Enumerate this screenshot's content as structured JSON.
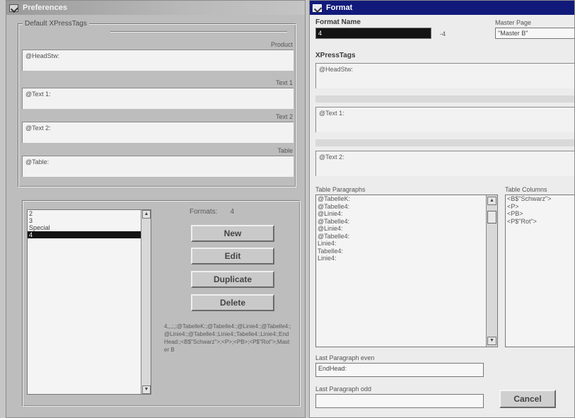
{
  "preferences": {
    "title": "Preferences",
    "tags_group": {
      "label": "Default XPressTags",
      "fields": [
        {
          "label": "Product",
          "value": "@HeadStw:"
        },
        {
          "label": "Text 1",
          "value": "@Text 1:"
        },
        {
          "label": "Text 2",
          "value": "@Text 2:"
        },
        {
          "label": "Table",
          "value": "@Table:"
        }
      ]
    },
    "formats_list": [
      "2",
      "3",
      "Special",
      "4"
    ],
    "formats_selected_index": 3,
    "formats_label": "Formats:",
    "formats_count": "4",
    "buttons": {
      "new": "New",
      "edit": "Edit",
      "duplicate": "Duplicate",
      "delete": "Delete"
    },
    "summary": "4,,,;,;@TabelleK:;@Tabelle4:;@Linie4:;@Tabelle4:;@Linie4:;@Tabelle4:;Linie4:;Tabelle4:;Linie4:;EndHead:;<B$\"Schwarz\">;<P>;<PB>;<P$\"Rot\">;Master B"
  },
  "format": {
    "title": "Format",
    "format_name_label": "Format Name",
    "format_name_value": "4",
    "format_name_suffix": "-4",
    "master_page_label": "Master Page",
    "master_page_value": "\"Master B\"",
    "xpresstags_label": "XPressTags",
    "tag_fields": [
      "@HeadStw:",
      "@Text 1:",
      "@Text 2:"
    ],
    "table_paragraphs_label": "Table Paragraphs",
    "table_paragraphs": [
      "@TabelleK:",
      "@Tabelle4:",
      "@Linie4:",
      "@Tabelle4:",
      "@Linie4:",
      "@Tabelle4:",
      "Linie4:",
      "Tabelle4:",
      "Linie4:"
    ],
    "table_columns_label": "Table Columns",
    "table_columns": [
      "<B$\"Schwarz\">",
      "<P>",
      "<PB>",
      "<P$\"Rot\">"
    ],
    "last_para_even_label": "Last Paragraph even",
    "last_para_even_value": "EndHead:",
    "last_para_odd_label": "Last Paragraph odd",
    "last_para_odd_value": "",
    "cancel_label": "Cancel"
  }
}
